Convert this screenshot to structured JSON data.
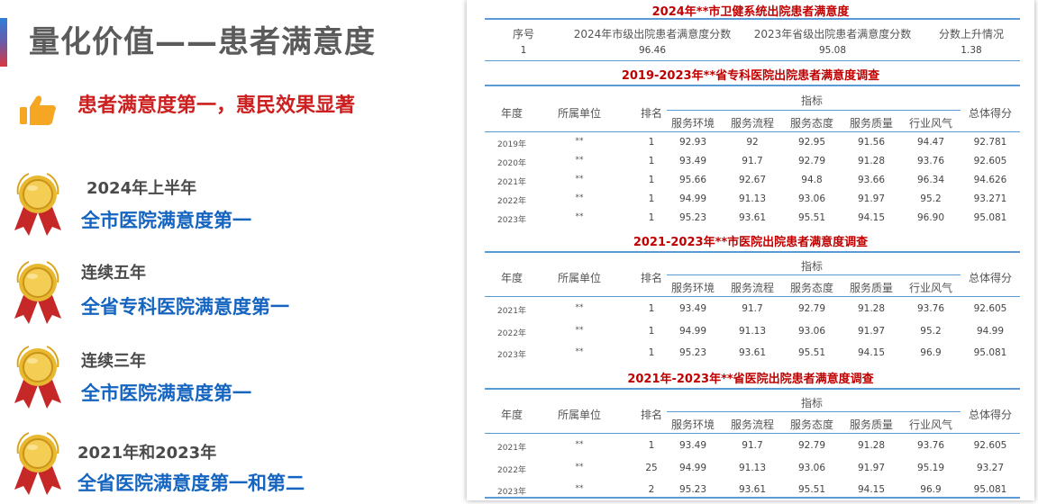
{
  "left": {
    "title": "量化价值——患者满意度",
    "headline": "患者满意度第一，惠民效果显著",
    "awards": [
      {
        "sub": "2024年上半年",
        "main": "全市医院满意度第一"
      },
      {
        "sub": "连续五年",
        "main": "全省专科医院满意度第一"
      },
      {
        "sub": "连续三年",
        "main": "全市医院满意度第一"
      },
      {
        "sub": "2021年和2023年",
        "main": "全省医院满意度第一和第二"
      }
    ],
    "colors": {
      "headline": "#cc1f1f",
      "award_main": "#1565c0",
      "medal": "#d9a521",
      "ribbon": "#c62828"
    }
  },
  "top_table": {
    "title": "2024年**市卫健系统出院患者满意度",
    "headers": [
      "序号",
      "2024年市级出院患者满意度分数",
      "2023年省级出院患者满意度分数",
      "分数上升情况"
    ],
    "row": [
      "1",
      "96.46",
      "95.08",
      "1.38"
    ]
  },
  "sections": [
    {
      "title": "2019-2023年**省专科医院出院患者满意度调查",
      "headers": {
        "year": "年度",
        "unit": "所属单位",
        "rank": "排名",
        "indicator": "指标",
        "total": "总体得分",
        "subs": [
          "服务环境",
          "服务流程",
          "服务态度",
          "服务质量",
          "行业风气"
        ]
      },
      "rows": [
        {
          "year": "2019年",
          "unit": "**",
          "rank": "1",
          "vals": [
            "92.93",
            "92",
            "92.95",
            "91.56",
            "94.47"
          ],
          "total": "92.781"
        },
        {
          "year": "2020年",
          "unit": "**",
          "rank": "1",
          "vals": [
            "93.49",
            "91.7",
            "92.79",
            "91.28",
            "93.76"
          ],
          "total": "92.605"
        },
        {
          "year": "2021年",
          "unit": "**",
          "rank": "1",
          "vals": [
            "95.66",
            "92.67",
            "94.8",
            "93.66",
            "96.34"
          ],
          "total": "94.626"
        },
        {
          "year": "2022年",
          "unit": "**",
          "rank": "1",
          "vals": [
            "94.99",
            "91.13",
            "93.06",
            "91.97",
            "95.2"
          ],
          "total": "93.271"
        },
        {
          "year": "2023年",
          "unit": "**",
          "rank": "1",
          "vals": [
            "95.23",
            "93.61",
            "95.51",
            "94.15",
            "96.90"
          ],
          "total": "95.081"
        }
      ]
    },
    {
      "title": "2021-2023年**市医院出院患者满意度调查",
      "headers": {
        "year": "年度",
        "unit": "所属单位",
        "rank": "排名",
        "indicator": "指标",
        "total": "总体得分",
        "subs": [
          "服务环境",
          "服务流程",
          "服务态度",
          "服务质量",
          "行业风气"
        ]
      },
      "rows": [
        {
          "year": "2021年",
          "unit": "**",
          "rank": "1",
          "vals": [
            "93.49",
            "91.7",
            "92.79",
            "91.28",
            "93.76"
          ],
          "total": "92.605"
        },
        {
          "year": "2022年",
          "unit": "**",
          "rank": "1",
          "vals": [
            "94.99",
            "91.13",
            "93.06",
            "91.97",
            "95.2"
          ],
          "total": "94.99"
        },
        {
          "year": "2023年",
          "unit": "**",
          "rank": "1",
          "vals": [
            "95.23",
            "93.61",
            "95.51",
            "94.15",
            "96.9"
          ],
          "total": "95.081"
        }
      ]
    },
    {
      "title": "2021年-2023年**省医院出院患者满意度调查",
      "headers": {
        "year": "年度",
        "unit": "所属单位",
        "rank": "排名",
        "indicator": "指标",
        "total": "总体得分",
        "subs": [
          "服务环境",
          "服务流程",
          "服务态度",
          "服务质量",
          "行业风气"
        ]
      },
      "rows": [
        {
          "year": "2021年",
          "unit": "**",
          "rank": "1",
          "vals": [
            "93.49",
            "91.7",
            "92.79",
            "91.28",
            "93.76"
          ],
          "total": "92.605"
        },
        {
          "year": "2022年",
          "unit": "**",
          "rank": "25",
          "vals": [
            "94.99",
            "91.13",
            "93.06",
            "91.97",
            "95.19"
          ],
          "total": "93.27"
        },
        {
          "year": "2023年",
          "unit": "**",
          "rank": "2",
          "vals": [
            "95.23",
            "93.61",
            "95.51",
            "94.15",
            "96.9"
          ],
          "total": "95.081"
        }
      ]
    }
  ]
}
